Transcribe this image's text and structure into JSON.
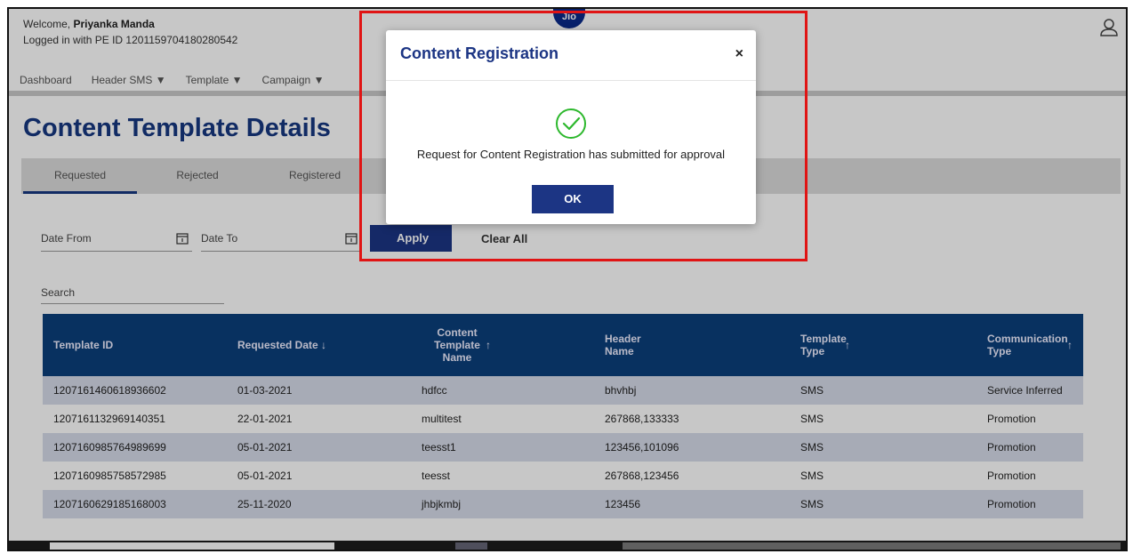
{
  "header": {
    "welcome_prefix": "Welcome,",
    "user_name": "Priyanka Manda",
    "pe_prefix": "Logged in with PE ID",
    "pe_id": "1201159704180280542"
  },
  "nav": {
    "items": [
      "Dashboard",
      "Header SMS ▼",
      "Template ▼",
      "Campaign ▼"
    ]
  },
  "page": {
    "title": "Content Template Details"
  },
  "tabs": [
    "Requested",
    "Rejected",
    "Registered"
  ],
  "filters": {
    "date_from": "Date From",
    "date_to": "Date To",
    "apply": "Apply",
    "clear_all": "Clear All",
    "search_placeholder": "Search"
  },
  "table": {
    "columns": [
      {
        "label": "Template ID"
      },
      {
        "label": "Requested Date ↓"
      },
      {
        "label": "Content Template Name"
      },
      {
        "label": "Header Name"
      },
      {
        "label": "Template Type"
      },
      {
        "label": "Communication Type"
      }
    ],
    "rows": [
      [
        "1207161460618936602",
        "01-03-2021",
        "hdfcc",
        "bhvhbj",
        "SMS",
        "Service Inferred"
      ],
      [
        "1207161132969140351",
        "22-01-2021",
        "multitest",
        "267868,133333",
        "SMS",
        "Promotion"
      ],
      [
        "1207160985764989699",
        "05-01-2021",
        "teesst1",
        "123456,101096",
        "SMS",
        "Promotion"
      ],
      [
        "1207160985758572985",
        "05-01-2021",
        "teesst",
        "267868,123456",
        "SMS",
        "Promotion"
      ],
      [
        "1207160629185168003",
        "25-11-2020",
        "jhbjkmbj",
        "123456",
        "SMS",
        "Promotion"
      ]
    ]
  },
  "modal": {
    "title": "Content Registration",
    "close": "×",
    "message": "Request for Content Registration has submitted for approval",
    "ok": "OK"
  },
  "colors": {
    "brand": "#1c3584",
    "table_header": "#0b3f7c",
    "success": "#2db82d",
    "highlight": "#e01414"
  }
}
